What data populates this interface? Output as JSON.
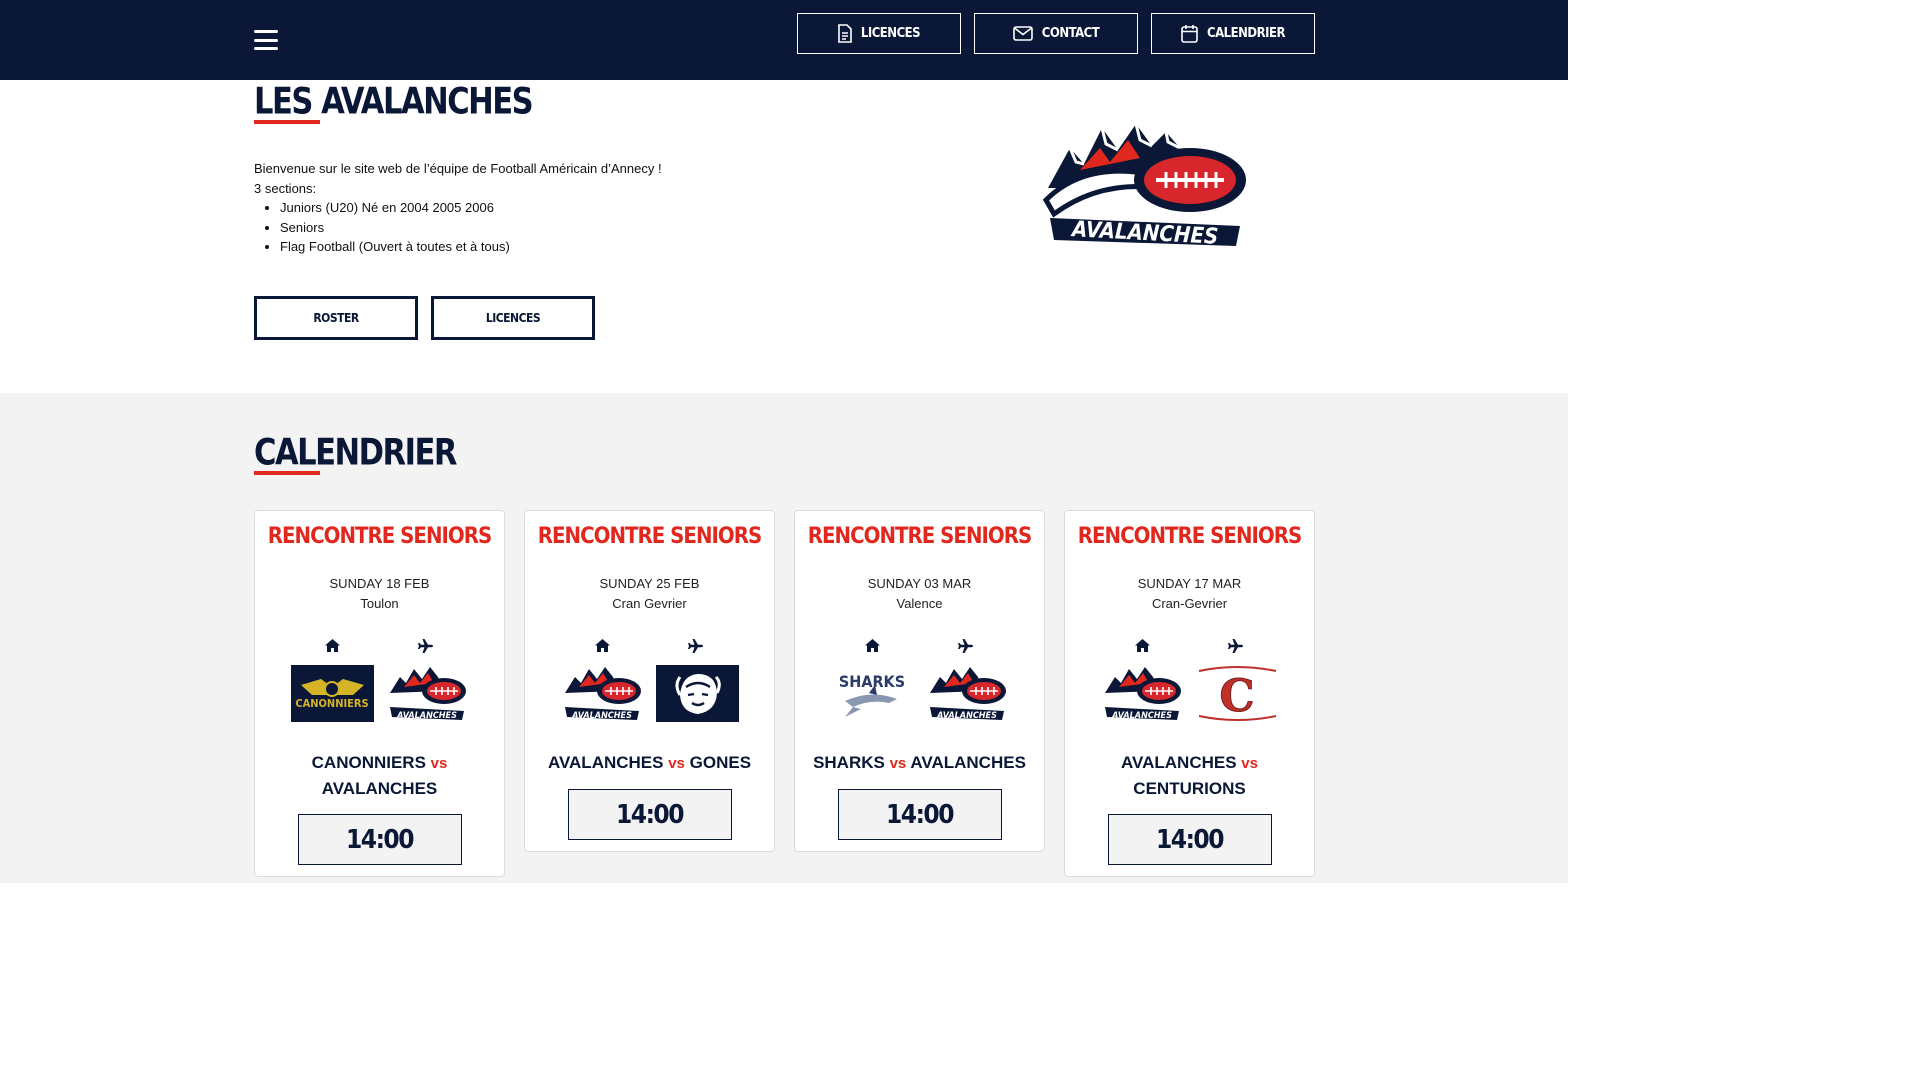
{
  "nav": {
    "buttons": [
      {
        "label": "LICENCES",
        "icon": "document-icon"
      },
      {
        "label": "CONTACT",
        "icon": "envelope-icon"
      },
      {
        "label": "CALENDRIER",
        "icon": "calendar-icon"
      }
    ],
    "menu_icon": "hamburger-menu-icon"
  },
  "hero": {
    "title": "LES AVALANCHES",
    "intro_line1": "Bienvenue sur le site web de l’équipe de Football Américain d’Annecy !",
    "intro_line2": "3 sections:",
    "sections": [
      "Juniors (U20) Né en 2004  2005  2006",
      "Seniors",
      "Flag Football (Ouvert à toutes et à tous)"
    ],
    "buttons": [
      "ROSTER",
      "LICENCES"
    ],
    "logo_text": "AVALANCHES"
  },
  "calendar": {
    "title": "CALENDRIER",
    "vs_label": "vs",
    "home_icon": "home-icon",
    "away_icon": "plane-icon",
    "matches": [
      {
        "title": "RENCONTRE SENIORS",
        "date": "SUNDAY 18 FEB",
        "place": "Toulon",
        "home": "CANONNIERS",
        "away": "AVALANCHES",
        "time": "14:00",
        "home_logo_text": "CANONNIERS",
        "away_logo_text": "AVALANCHES"
      },
      {
        "title": "RENCONTRE SENIORS",
        "date": "SUNDAY 25 FEB",
        "place": "Cran Gevrier",
        "home": "AVALANCHES",
        "away": "GONES",
        "time": "14:00",
        "home_logo_text": "AVALANCHES",
        "away_logo_text": ""
      },
      {
        "title": "RENCONTRE SENIORS",
        "date": "SUNDAY 03 MAR",
        "place": "Valence",
        "home": "SHARKS",
        "away": "AVALANCHES",
        "time": "14:00",
        "home_logo_text": "SHARKS",
        "away_logo_text": "AVALANCHES"
      },
      {
        "title": "RENCONTRE SENIORS",
        "date": "SUNDAY 17 MAR",
        "place": "Cran-Gevrier",
        "home": "AVALANCHES",
        "away": "CENTURIONS",
        "time": "14:00",
        "home_logo_text": "AVALANCHES",
        "away_logo_text": "C"
      }
    ]
  },
  "colors": {
    "navy": "#0b1736",
    "accent_red": "#e0281f",
    "section_gray": "#f3f3f3"
  }
}
